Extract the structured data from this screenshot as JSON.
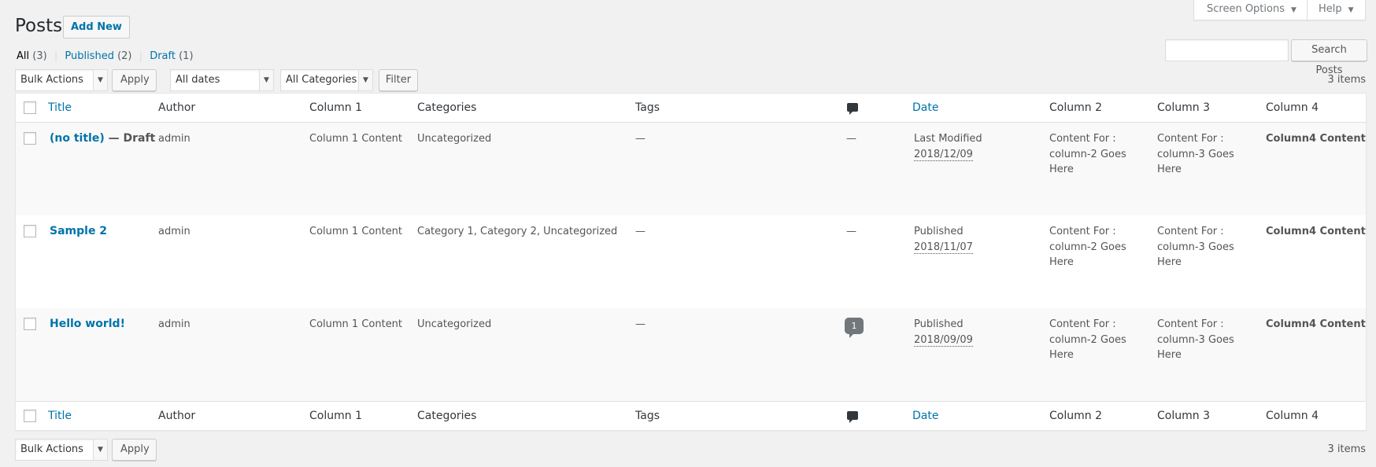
{
  "header": {
    "title": "Posts",
    "add_new": "Add New",
    "screen_options": "Screen Options",
    "help": "Help"
  },
  "views": {
    "all": {
      "label": "All",
      "count": "(3)"
    },
    "published": {
      "label": "Published",
      "count": "(2)"
    },
    "draft": {
      "label": "Draft",
      "count": "(1)"
    },
    "separator": "|"
  },
  "search": {
    "button": "Search Posts",
    "value": ""
  },
  "tablenav_top": {
    "bulk_actions": "Bulk Actions",
    "apply": "Apply",
    "dates": "All dates",
    "categories": "All Categories",
    "filter": "Filter",
    "items": "3 items"
  },
  "tablenav_bottom": {
    "bulk_actions": "Bulk Actions",
    "apply": "Apply",
    "items": "3 items"
  },
  "columns": {
    "title": "Title",
    "author": "Author",
    "col1": "Column 1",
    "categories": "Categories",
    "tags": "Tags",
    "date": "Date",
    "col2": "Column 2",
    "col3": "Column 3",
    "col4": "Column 4"
  },
  "rows": [
    {
      "title": "(no title)",
      "state": " — Draft",
      "author": "admin",
      "col1": "Column 1 Content",
      "categories": "Uncategorized",
      "tags": "—",
      "comments": "—",
      "date_status": "Last Modified",
      "date": "2018/12/09",
      "col2_a": "Content For :",
      "col2_b": "column-2 Goes",
      "col2_c": "Here",
      "col3_a": "Content For :",
      "col3_b": "column-3 Goes",
      "col3_c": "Here",
      "col4": "Column4 Content"
    },
    {
      "title": "Sample 2",
      "state": "",
      "author": "admin",
      "col1": "Column 1 Content",
      "categories": "Category 1, Category 2, Uncategorized",
      "tags": "—",
      "comments": "—",
      "date_status": "Published",
      "date": "2018/11/07",
      "col2_a": "Content For :",
      "col2_b": "column-2 Goes",
      "col2_c": "Here",
      "col3_a": "Content For :",
      "col3_b": "column-3 Goes",
      "col3_c": "Here",
      "col4": "Column4 Content"
    },
    {
      "title": "Hello world!",
      "state": "",
      "author": "admin",
      "col1": "Column 1 Content",
      "categories": "Uncategorized",
      "tags": "—",
      "comments": "1",
      "date_status": "Published",
      "date": "2018/09/09",
      "col2_a": "Content For :",
      "col2_b": "column-2 Goes",
      "col2_c": "Here",
      "col3_a": "Content For :",
      "col3_b": "column-3 Goes",
      "col3_c": "Here",
      "col4": "Column4 Content"
    }
  ],
  "icons": {
    "comments_header": "comment-bubble-icon",
    "dropdown_caret": "triangle-down-icon"
  },
  "colors": {
    "link": "#0073aa",
    "background": "#f1f1f1",
    "alt_row": "#f9f9f9"
  }
}
